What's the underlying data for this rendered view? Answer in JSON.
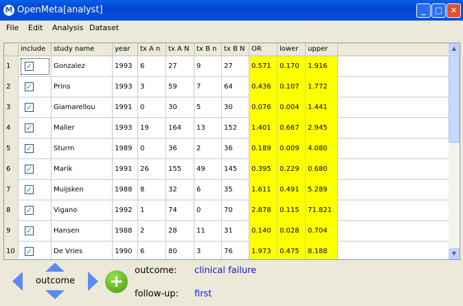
{
  "window": {
    "title": "OpenMeta[analyst]",
    "logo": "M"
  },
  "menu": [
    "File",
    "Edit",
    "Analysis",
    "Dataset"
  ],
  "columns": [
    "include",
    "study name",
    "year",
    "tx A n",
    "tx A N",
    "tx B n",
    "tx B N",
    "OR",
    "lower",
    "upper"
  ],
  "rows": [
    {
      "n": "1",
      "include": true,
      "name": "Gonzalez",
      "year": "1993",
      "an": "6",
      "aN": "27",
      "bn": "9",
      "bN": "27",
      "or": "0.571",
      "lower": "0.170",
      "upper": "1.916"
    },
    {
      "n": "2",
      "include": true,
      "name": "Prins",
      "year": "1993",
      "an": "3",
      "aN": "59",
      "bn": "7",
      "bN": "64",
      "or": "0.436",
      "lower": "0.107",
      "upper": "1.772"
    },
    {
      "n": "3",
      "include": true,
      "name": "Giamarellou",
      "year": "1991",
      "an": "0",
      "aN": "30",
      "bn": "5",
      "bN": "30",
      "or": "0.076",
      "lower": "0.004",
      "upper": "1.441"
    },
    {
      "n": "4",
      "include": true,
      "name": "Maller",
      "year": "1993",
      "an": "19",
      "aN": "164",
      "bn": "13",
      "bN": "152",
      "or": "1.401",
      "lower": "0.667",
      "upper": "2.945"
    },
    {
      "n": "5",
      "include": true,
      "name": "Sturm",
      "year": "1989",
      "an": "0",
      "aN": "36",
      "bn": "2",
      "bN": "36",
      "or": "0.189",
      "lower": "0.009",
      "upper": "4.080"
    },
    {
      "n": "6",
      "include": true,
      "name": "Marik",
      "year": "1991",
      "an": "26",
      "aN": "155",
      "bn": "49",
      "bN": "145",
      "or": "0.395",
      "lower": "0.229",
      "upper": "0.680"
    },
    {
      "n": "7",
      "include": true,
      "name": "Muijsken",
      "year": "1988",
      "an": "8",
      "aN": "32",
      "bn": "6",
      "bN": "35",
      "or": "1.611",
      "lower": "0.491",
      "upper": "5.289"
    },
    {
      "n": "8",
      "include": true,
      "name": "Vigano",
      "year": "1992",
      "an": "1",
      "aN": "74",
      "bn": "0",
      "bN": "70",
      "or": "2.878",
      "lower": "0.115",
      "upper": "71.821"
    },
    {
      "n": "9",
      "include": true,
      "name": "Hansen",
      "year": "1988",
      "an": "2",
      "aN": "28",
      "bn": "11",
      "bN": "31",
      "or": "0.140",
      "lower": "0.028",
      "upper": "0.704"
    },
    {
      "n": "10",
      "include": true,
      "name": "De Vries",
      "year": "1990",
      "an": "6",
      "aN": "80",
      "bn": "3",
      "bN": "76",
      "or": "1.973",
      "lower": "0.475",
      "upper": "8.188"
    }
  ],
  "bottom": {
    "nav_label": "outcome",
    "outcome_label": "outcome:",
    "outcome_value": "clinical failure",
    "followup_label": "follow-up:",
    "followup_value": "first"
  },
  "colors": {
    "highlight": "#ffff00",
    "value_text": "#1515e0",
    "nav_arrow": "#5b8af5"
  }
}
